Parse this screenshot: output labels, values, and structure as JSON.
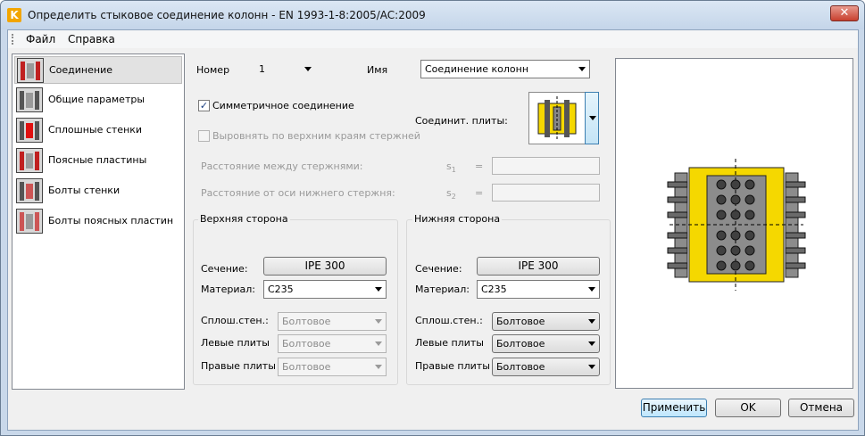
{
  "window": {
    "title": "Определить стыковое соединение колонн - EN 1993-1-8:2005/AC:2009",
    "close_glyph": "✕",
    "app_icon_letter": "K"
  },
  "menu": {
    "items": [
      {
        "label": "Файл"
      },
      {
        "label": "Справка"
      }
    ]
  },
  "nav": {
    "items": [
      {
        "label": "Соединение",
        "icon": "column-joint-icon"
      },
      {
        "label": "Общие параметры",
        "icon": "general-params-icon"
      },
      {
        "label": "Сплошные стенки",
        "icon": "web-plate-icon"
      },
      {
        "label": "Поясные пластины",
        "icon": "flange-plate-icon"
      },
      {
        "label": "Болты стенки",
        "icon": "web-bolts-icon"
      },
      {
        "label": "Болты поясных пластин",
        "icon": "flange-bolts-icon"
      }
    ],
    "selected_index": 0
  },
  "form": {
    "number_label": "Номер",
    "number_value": "1",
    "name_label": "Имя",
    "name_value": "Соединение колонн",
    "symmetric_label": "Симметричное соединение",
    "symmetric_checked": true,
    "check_mark": "✓",
    "align_label": "Выровнять по верхним краям стержней",
    "plates_label": "Соединит. плиты:",
    "distance_label": "Расстояние между стержнями:",
    "s1_symbol": "s",
    "s1_sub": "1",
    "s2_symbol": "s",
    "s2_sub": "2",
    "eq": "=",
    "offset_label": "Расстояние от оси нижнего стержня:"
  },
  "upper": {
    "title": "Верхняя сторона",
    "section_label": "Сечение:",
    "section_value": "IPE 300",
    "material_label": "Материал:",
    "material_value": "C235",
    "web_label": "Сплош.стен.:",
    "web_value": "Болтовое",
    "left_label": "Левые плиты",
    "left_value": "Болтовое",
    "right_label": "Правые плиты",
    "right_value": "Болтовое"
  },
  "lower": {
    "title": "Нижняя сторона",
    "section_label": "Сечение:",
    "section_value": "IPE 300",
    "material_label": "Материал:",
    "material_value": "C235",
    "web_label": "Сплош.стен.:",
    "web_value": "Болтовое",
    "left_label": "Левые плиты",
    "left_value": "Болтовое",
    "right_label": "Правые плиты",
    "right_value": "Болтовое"
  },
  "buttons": {
    "apply": "Применить",
    "ok": "OK",
    "cancel": "Отмена"
  },
  "colors": {
    "plate_yellow": "#f5d800",
    "steel_gray": "#8c8c8c",
    "bolt_dark": "#404040",
    "accent_blue": "#3c7fb1"
  }
}
